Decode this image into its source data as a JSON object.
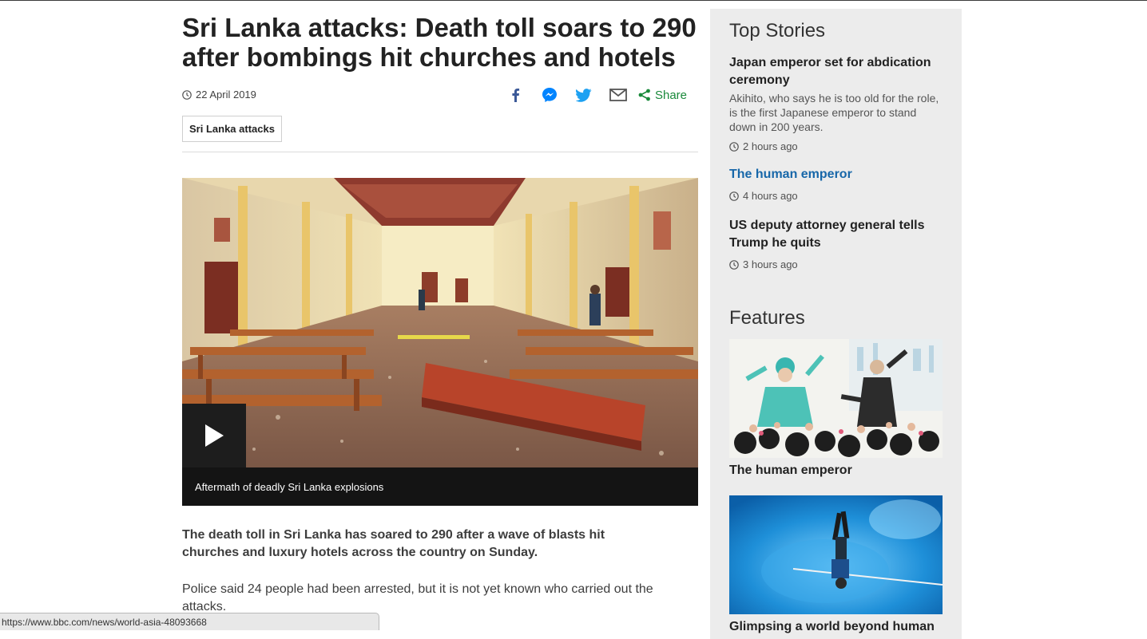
{
  "article": {
    "headline": "Sri Lanka attacks: Death toll soars to 290 after bombings hit churches and hotels",
    "date": "22 April 2019",
    "share_label": "Share",
    "share_buttons": [
      "facebook-icon",
      "messenger-icon",
      "twitter-icon",
      "email-icon",
      "share-icon"
    ],
    "tag": "Sri Lanka attacks",
    "video_caption": "Aftermath of deadly Sri Lanka explosions",
    "intro": "The death toll in Sri Lanka has soared to 290 after a wave of blasts hit churches and luxury hotels across the country on Sunday.",
    "paragraph_1": "Police said 24 people had been arrested, but it is not yet known who carried out the attacks."
  },
  "sidebar": {
    "top_stories_heading": "Top Stories",
    "stories": [
      {
        "title": "Japan emperor set for abdication ceremony",
        "summary": "Akihito, who says he is too old for the role, is the first Japanese emperor to stand down in 200 years.",
        "time": "2 hours ago"
      },
      {
        "title": "The human emperor",
        "time": "4 hours ago"
      },
      {
        "title": "US deputy attorney general tells Trump he quits",
        "time": "3 hours ago"
      }
    ],
    "features_heading": "Features",
    "features": [
      {
        "title": "The human emperor"
      },
      {
        "title": "Glimpsing a world beyond human"
      }
    ]
  },
  "status_bar": {
    "url": "https://www.bbc.com/news/world-asia-48093668"
  },
  "colors": {
    "share_green": "#1a8a3b",
    "facebook_blue": "#3b5998",
    "messenger_blue": "#0084ff",
    "twitter_blue": "#1da1f2",
    "link_blue": "#1767a9",
    "sidebar_bg": "#ececec"
  }
}
